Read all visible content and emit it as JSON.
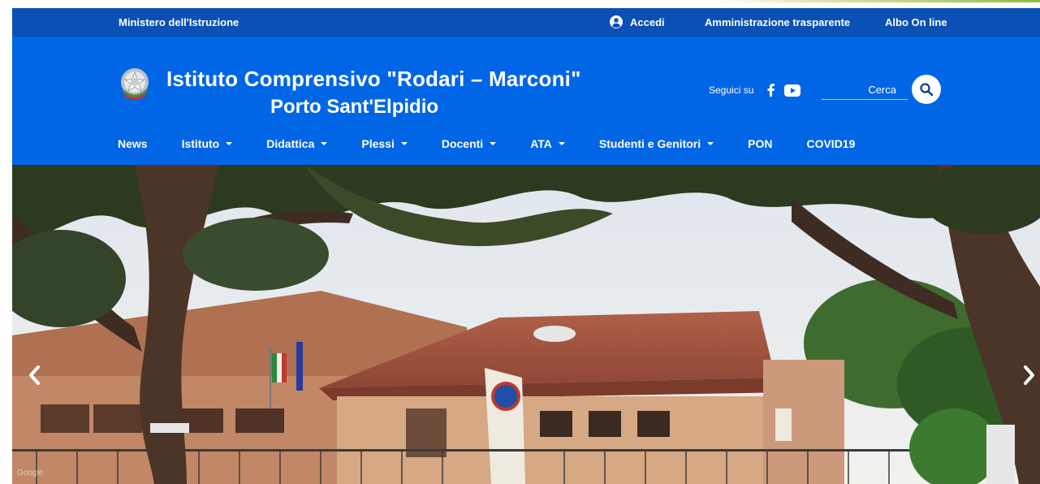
{
  "topbar": {
    "ministry": "Ministero dell'Istruzione",
    "login": "Accedi",
    "links": [
      "Amministrazione trasparente",
      "Albo On line"
    ]
  },
  "header": {
    "title_line1": "Istituto Comprensivo \"Rodari – Marconi\"",
    "title_line2": "Porto Sant'Elpidio",
    "social_label": "Seguici su",
    "social_icons": [
      "facebook-icon",
      "youtube-icon"
    ],
    "search_label": "Cerca"
  },
  "nav": {
    "items": [
      {
        "label": "News",
        "dropdown": false
      },
      {
        "label": "Istituto",
        "dropdown": true
      },
      {
        "label": "Didattica",
        "dropdown": true
      },
      {
        "label": "Plessi",
        "dropdown": true
      },
      {
        "label": "Docenti",
        "dropdown": true
      },
      {
        "label": "ATA",
        "dropdown": true
      },
      {
        "label": "Studenti e Genitori",
        "dropdown": true
      },
      {
        "label": "PON",
        "dropdown": false
      },
      {
        "label": "COVID19",
        "dropdown": false
      }
    ]
  },
  "hero": {
    "watermark": "Google",
    "prev_icon": "chevron-left-icon",
    "next_icon": "chevron-right-icon"
  },
  "colors": {
    "slim_bar": "#0a50b5",
    "header_blue": "#0066e6",
    "text": "#ffffff"
  }
}
